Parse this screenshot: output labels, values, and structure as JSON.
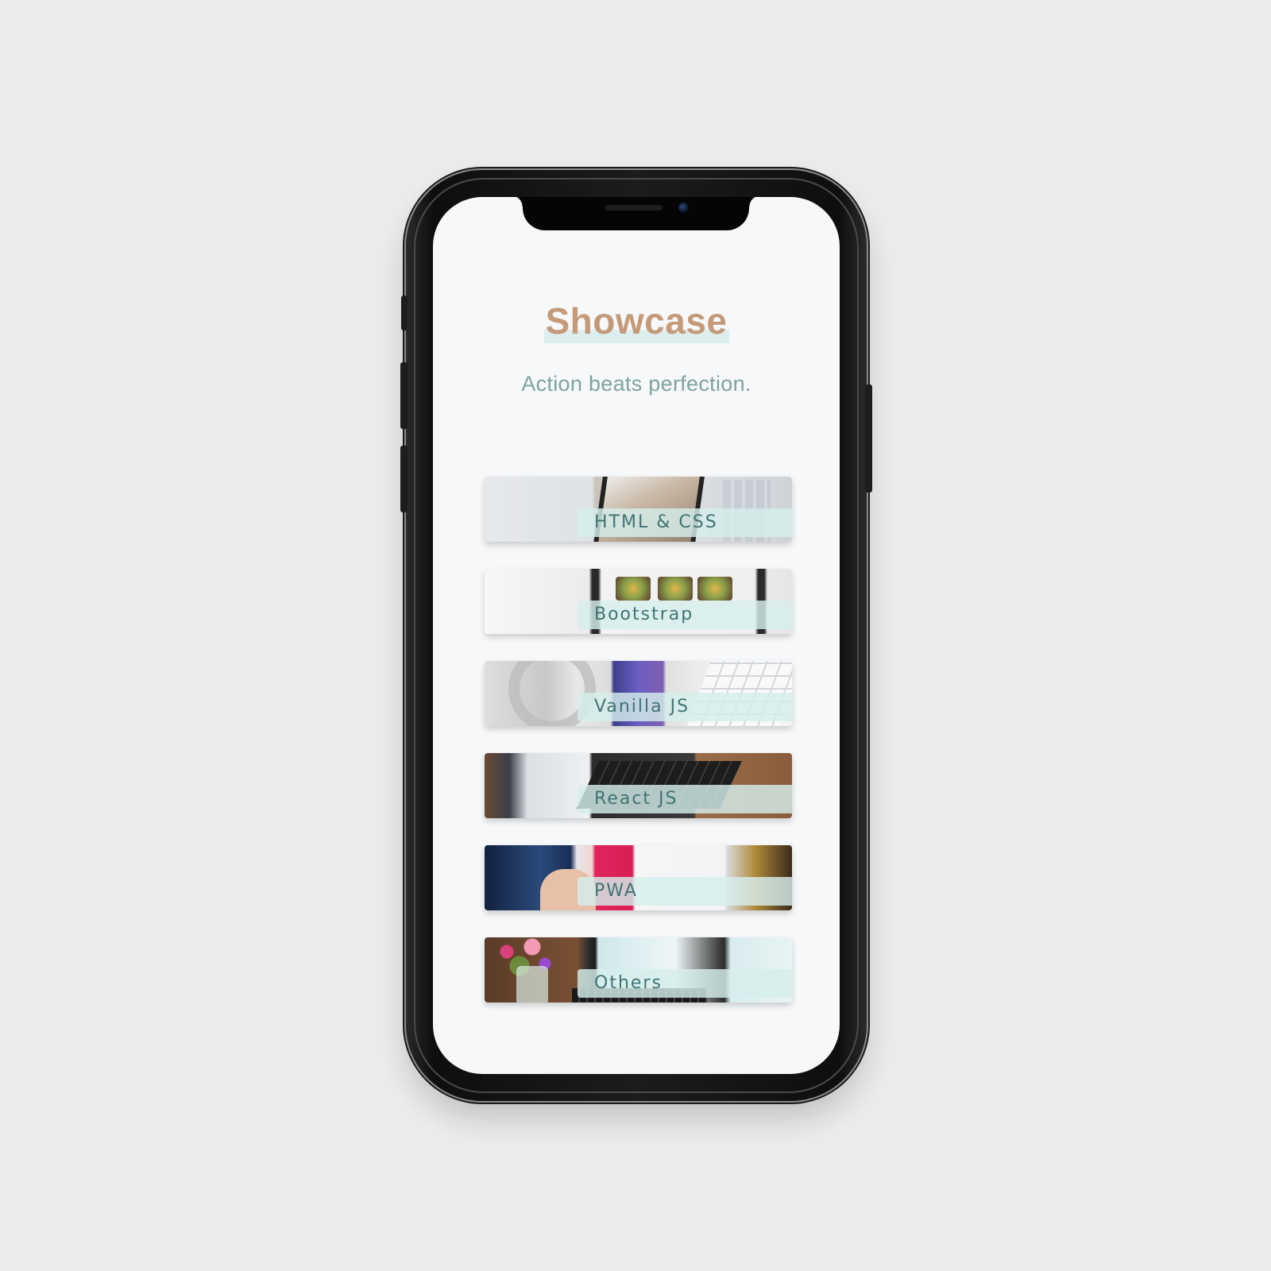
{
  "page": {
    "title": "Showcase",
    "subtitle": "Action beats perfection."
  },
  "cards": [
    {
      "label": "HTML & CSS",
      "icon": "photo-devices-city"
    },
    {
      "label": "Bootstrap",
      "icon": "photo-food-app-screens"
    },
    {
      "label": "Vanilla JS",
      "icon": "photo-headphones-phone-keyboard"
    },
    {
      "label": "React JS",
      "icon": "photo-laptop-dashboard"
    },
    {
      "label": "PWA",
      "icon": "photo-hand-tablet-app"
    },
    {
      "label": "Others",
      "icon": "photo-flowers-laptop"
    }
  ],
  "colors": {
    "background": "#ececec",
    "screen": "#f6f8fa",
    "title": "#c49a78",
    "title_highlight": "#dcefee",
    "subtitle": "#7fa39d",
    "card_label": "#3f7472",
    "card_label_bg": "#d6eeec"
  }
}
